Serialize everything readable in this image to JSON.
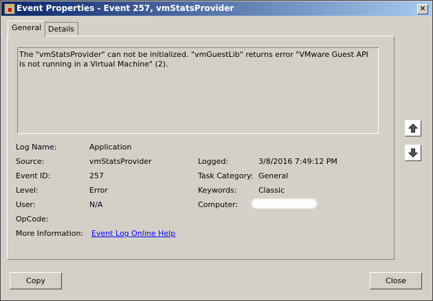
{
  "window": {
    "title": "Event Properties - Event 257, vmStatsProvider",
    "close": "✕"
  },
  "tabs": [
    {
      "label": "General"
    },
    {
      "label": "Details"
    }
  ],
  "message": "The \"vmStatsProvider\" can not be initialized. \"vmGuestLib\" returns error \"VMware Guest API is not running in a Virtual Machine\" (2).",
  "fields": {
    "log_name": {
      "label": "Log Name:",
      "value": "Application"
    },
    "source": {
      "label": "Source:",
      "value": "vmStatsProvider"
    },
    "event_id": {
      "label": "Event ID:",
      "value": "257"
    },
    "level": {
      "label": "Level:",
      "value": "Error"
    },
    "user": {
      "label": "User:",
      "value": "N/A"
    },
    "opcode": {
      "label": "OpCode:",
      "value": ""
    },
    "more_info": {
      "label": "More Information:",
      "value": "Event Log Online Help"
    },
    "logged": {
      "label": "Logged:",
      "value": "3/8/2016 7:49:12 PM"
    },
    "task_category": {
      "label": "Task Category:",
      "value": "General"
    },
    "keywords": {
      "label": "Keywords:",
      "value": "Classic"
    },
    "computer": {
      "label": "Computer:",
      "value": ""
    }
  },
  "buttons": {
    "copy": "Copy",
    "close": "Close"
  }
}
